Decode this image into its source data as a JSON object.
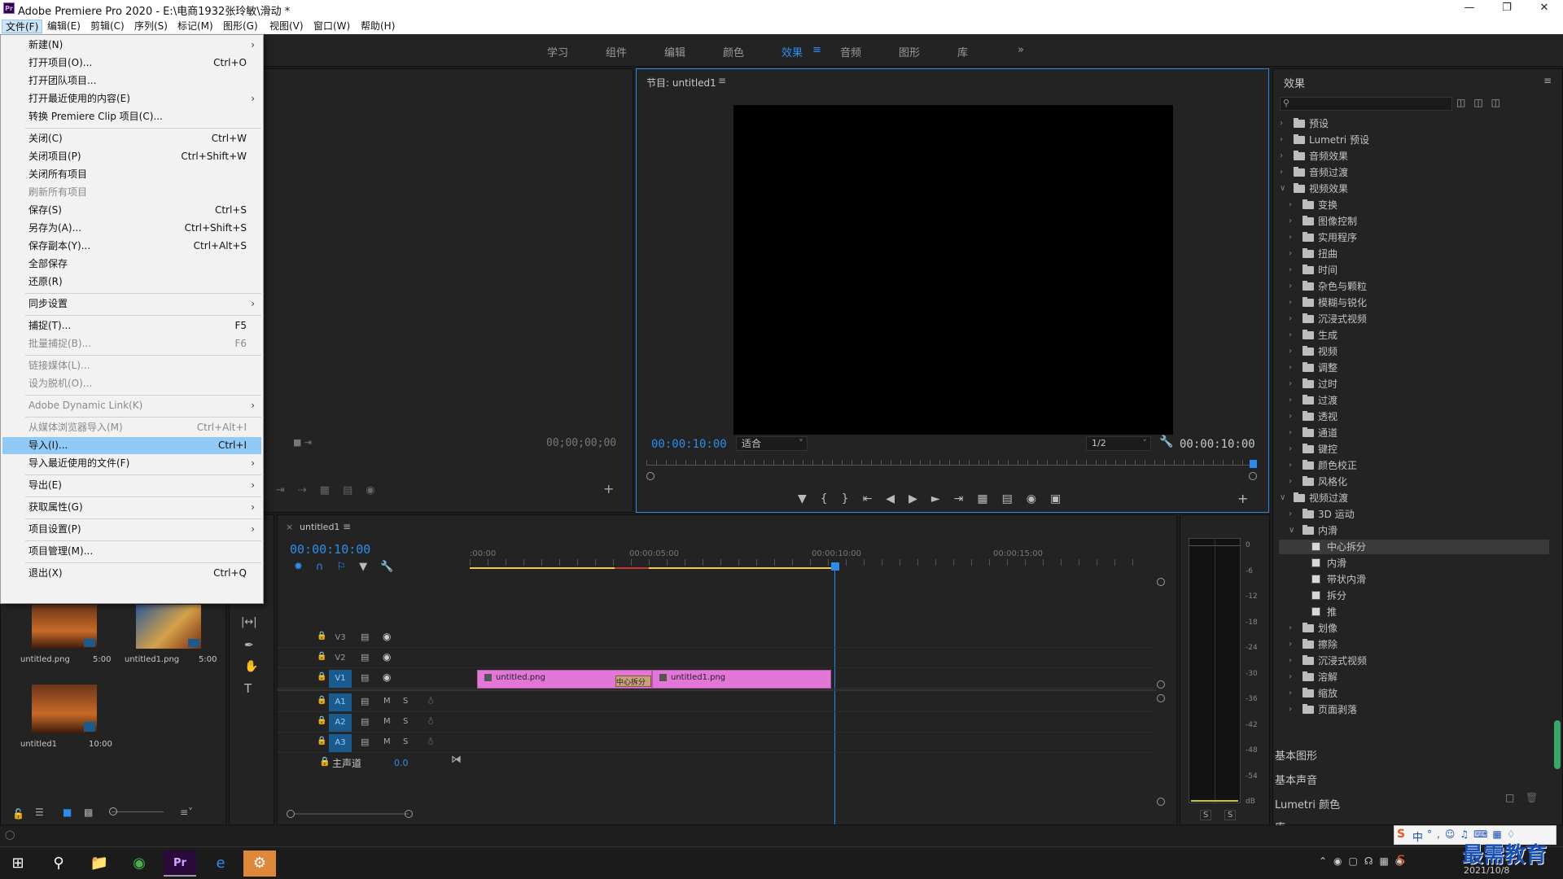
{
  "window": {
    "title": "Adobe Premiere Pro 2020 - E:\\电商1932张玲敏\\滑动 *",
    "app_icon": "Pr",
    "controls": [
      "minimize-icon",
      "restore-icon",
      "close-icon"
    ]
  },
  "menubar": [
    "文件(F)",
    "编辑(E)",
    "剪辑(C)",
    "序列(S)",
    "标记(M)",
    "图形(G)",
    "视图(V)",
    "窗口(W)",
    "帮助(H)"
  ],
  "workspaces": {
    "items": [
      "学习",
      "组件",
      "编辑",
      "颜色",
      "效果",
      "音频",
      "图形",
      "库"
    ],
    "active": "效果",
    "more": "»"
  },
  "file_menu": [
    {
      "label": "新建(N)",
      "shortcut": "",
      "submenu": true,
      "disabled": false
    },
    {
      "label": "打开项目(O)...",
      "shortcut": "Ctrl+O",
      "submenu": false,
      "disabled": false
    },
    {
      "label": "打开团队项目...",
      "shortcut": "",
      "submenu": false,
      "disabled": false
    },
    {
      "label": "打开最近使用的内容(E)",
      "shortcut": "",
      "submenu": true,
      "disabled": false
    },
    {
      "label": "转换 Premiere Clip 项目(C)...",
      "shortcut": "",
      "submenu": false,
      "disabled": false
    },
    {
      "sep": true
    },
    {
      "label": "关闭(C)",
      "shortcut": "Ctrl+W",
      "submenu": false,
      "disabled": false
    },
    {
      "label": "关闭项目(P)",
      "shortcut": "Ctrl+Shift+W",
      "submenu": false,
      "disabled": false
    },
    {
      "label": "关闭所有项目",
      "shortcut": "",
      "submenu": false,
      "disabled": false
    },
    {
      "label": "刷新所有项目",
      "shortcut": "",
      "submenu": false,
      "disabled": true
    },
    {
      "label": "保存(S)",
      "shortcut": "Ctrl+S",
      "submenu": false,
      "disabled": false
    },
    {
      "label": "另存为(A)...",
      "shortcut": "Ctrl+Shift+S",
      "submenu": false,
      "disabled": false
    },
    {
      "label": "保存副本(Y)...",
      "shortcut": "Ctrl+Alt+S",
      "submenu": false,
      "disabled": false
    },
    {
      "label": "全部保存",
      "shortcut": "",
      "submenu": false,
      "disabled": false
    },
    {
      "label": "还原(R)",
      "shortcut": "",
      "submenu": false,
      "disabled": false
    },
    {
      "sep": true
    },
    {
      "label": "同步设置",
      "shortcut": "",
      "submenu": true,
      "disabled": false
    },
    {
      "sep": true
    },
    {
      "label": "捕捉(T)...",
      "shortcut": "F5",
      "submenu": false,
      "disabled": false
    },
    {
      "label": "批量捕捉(B)...",
      "shortcut": "F6",
      "submenu": false,
      "disabled": true
    },
    {
      "sep": true
    },
    {
      "label": "链接媒体(L)...",
      "shortcut": "",
      "submenu": false,
      "disabled": true
    },
    {
      "label": "设为脱机(O)...",
      "shortcut": "",
      "submenu": false,
      "disabled": true
    },
    {
      "sep": true
    },
    {
      "label": "Adobe Dynamic Link(K)",
      "shortcut": "",
      "submenu": true,
      "disabled": true
    },
    {
      "sep": true
    },
    {
      "label": "从媒体浏览器导入(M)",
      "shortcut": "Ctrl+Alt+I",
      "submenu": false,
      "disabled": true
    },
    {
      "label": "导入(I)...",
      "shortcut": "Ctrl+I",
      "submenu": false,
      "disabled": false,
      "highlight": true
    },
    {
      "label": "导入最近使用的文件(F)",
      "shortcut": "",
      "submenu": true,
      "disabled": false
    },
    {
      "sep": true
    },
    {
      "label": "导出(E)",
      "shortcut": "",
      "submenu": true,
      "disabled": false
    },
    {
      "sep": true
    },
    {
      "label": "获取属性(G)",
      "shortcut": "",
      "submenu": true,
      "disabled": false
    },
    {
      "sep": true
    },
    {
      "label": "项目设置(P)",
      "shortcut": "",
      "submenu": true,
      "disabled": false
    },
    {
      "sep": true
    },
    {
      "label": "项目管理(M)...",
      "shortcut": "",
      "submenu": false,
      "disabled": false
    },
    {
      "sep": true
    },
    {
      "label": "退出(X)",
      "shortcut": "Ctrl+Q",
      "submenu": false,
      "disabled": false
    }
  ],
  "source_monitor": {
    "timecode": "00;00;00;00"
  },
  "program_monitor": {
    "title": "节目: untitled1",
    "timecode_left": "00:00:10:00",
    "fit": "适合",
    "resolution": "1/2",
    "timecode_right": "00:00:10:00"
  },
  "effects_panel": {
    "title": "效果",
    "tree": [
      {
        "label": "预设",
        "level": 0,
        "kind": "folder-star",
        "open": false
      },
      {
        "label": "Lumetri 预设",
        "level": 0,
        "kind": "folder-star",
        "open": false
      },
      {
        "label": "音频效果",
        "level": 0,
        "kind": "folder",
        "open": false
      },
      {
        "label": "音频过渡",
        "level": 0,
        "kind": "folder",
        "open": false
      },
      {
        "label": "视频效果",
        "level": 0,
        "kind": "folder",
        "open": true
      },
      {
        "label": "变换",
        "level": 1,
        "kind": "folder",
        "open": false
      },
      {
        "label": "图像控制",
        "level": 1,
        "kind": "folder",
        "open": false
      },
      {
        "label": "实用程序",
        "level": 1,
        "kind": "folder",
        "open": false
      },
      {
        "label": "扭曲",
        "level": 1,
        "kind": "folder",
        "open": false
      },
      {
        "label": "时间",
        "level": 1,
        "kind": "folder",
        "open": false
      },
      {
        "label": "杂色与颗粒",
        "level": 1,
        "kind": "folder",
        "open": false
      },
      {
        "label": "模糊与锐化",
        "level": 1,
        "kind": "folder",
        "open": false
      },
      {
        "label": "沉浸式视频",
        "level": 1,
        "kind": "folder",
        "open": false
      },
      {
        "label": "生成",
        "level": 1,
        "kind": "folder",
        "open": false
      },
      {
        "label": "视频",
        "level": 1,
        "kind": "folder",
        "open": false
      },
      {
        "label": "调整",
        "level": 1,
        "kind": "folder",
        "open": false
      },
      {
        "label": "过时",
        "level": 1,
        "kind": "folder",
        "open": false
      },
      {
        "label": "过渡",
        "level": 1,
        "kind": "folder",
        "open": false
      },
      {
        "label": "透视",
        "level": 1,
        "kind": "folder",
        "open": false
      },
      {
        "label": "通道",
        "level": 1,
        "kind": "folder",
        "open": false
      },
      {
        "label": "键控",
        "level": 1,
        "kind": "folder",
        "open": false
      },
      {
        "label": "颜色校正",
        "level": 1,
        "kind": "folder",
        "open": false
      },
      {
        "label": "风格化",
        "level": 1,
        "kind": "folder",
        "open": false
      },
      {
        "label": "视频过渡",
        "level": 0,
        "kind": "folder",
        "open": true
      },
      {
        "label": "3D 运动",
        "level": 1,
        "kind": "folder",
        "open": false
      },
      {
        "label": "内滑",
        "level": 1,
        "kind": "folder",
        "open": true
      },
      {
        "label": "中心拆分",
        "level": 2,
        "kind": "fx",
        "selected": true
      },
      {
        "label": "内滑",
        "level": 2,
        "kind": "fx"
      },
      {
        "label": "带状内滑",
        "level": 2,
        "kind": "fx"
      },
      {
        "label": "拆分",
        "level": 2,
        "kind": "fx"
      },
      {
        "label": "推",
        "level": 2,
        "kind": "fx"
      },
      {
        "label": "划像",
        "level": 1,
        "kind": "folder",
        "open": false
      },
      {
        "label": "擦除",
        "level": 1,
        "kind": "folder",
        "open": false
      },
      {
        "label": "沉浸式视频",
        "level": 1,
        "kind": "folder",
        "open": false
      },
      {
        "label": "溶解",
        "level": 1,
        "kind": "folder",
        "open": false
      },
      {
        "label": "缩放",
        "level": 1,
        "kind": "folder",
        "open": false
      },
      {
        "label": "页面剥落",
        "level": 1,
        "kind": "folder",
        "open": false
      }
    ],
    "collapsed_sections": [
      "基本图形",
      "基本声音",
      "Lumetri 颜色",
      "库"
    ]
  },
  "project": {
    "items": [
      {
        "name": "untitled.png",
        "duration": "5:00"
      },
      {
        "name": "untitled1.png",
        "duration": "5:00"
      },
      {
        "name": "untitled1",
        "duration": "10:00"
      }
    ]
  },
  "timeline": {
    "tab": "untitled1",
    "timecode": "00:00:10:00",
    "ruler": [
      ":00:00",
      "00:00:05:00",
      "00:00:10:00",
      "00:00:15:00"
    ],
    "video_tracks": [
      "V3",
      "V2",
      "V1"
    ],
    "audio_tracks": [
      "A1",
      "A2",
      "A3"
    ],
    "master": {
      "label": "主声道",
      "value": "0.0"
    },
    "clips": [
      {
        "name": "untitled.png",
        "track": "V1"
      },
      {
        "name": "untitled1.png",
        "track": "V1"
      }
    ],
    "transition_label": "中心拆分"
  },
  "meter": {
    "scale": [
      "0",
      "-6",
      "-12",
      "-18",
      "-24",
      "-30",
      "-36",
      "-42",
      "-48",
      "-54",
      "dB"
    ],
    "solo": [
      "S",
      "S"
    ]
  },
  "taskbar": {
    "clock_time": "",
    "clock_date": "2021/10/8",
    "ime": "中",
    "watermark": "最需教育"
  },
  "colors": {
    "accent": "#2d8ceb",
    "clip": "#e377d8",
    "menu_highlight": "#91c9f7"
  }
}
